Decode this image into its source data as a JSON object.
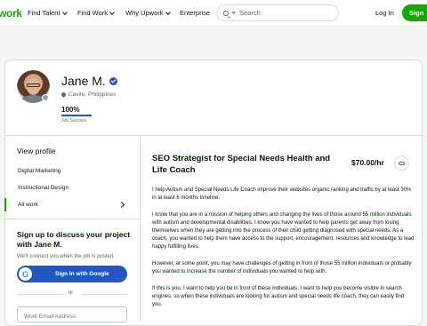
{
  "topbar": {
    "logo": "work",
    "nav": [
      "Find Talent",
      "Find Work",
      "Why Upwork",
      "Enterprise"
    ],
    "search_placeholder": "Search",
    "login": "Log In",
    "signup": "Sign"
  },
  "profile": {
    "name": "Jane M.",
    "location": "Cavite, Philippines",
    "jss_value": "100%",
    "jss_label": "Job Success",
    "jss_fraction": 1.0
  },
  "sidebar": {
    "view_profile": "View profile",
    "items": [
      {
        "label": "Digital Marketing"
      },
      {
        "label": "Instructional Design"
      },
      {
        "label": "All work"
      }
    ],
    "signup_title": "Sign up to discuss your project with Jane M.",
    "signup_sub": "We'll connect you when the job is posted.",
    "google_letter": "G",
    "google_label": "Sign In with Google",
    "or": "or",
    "email_placeholder": "Work Email Address"
  },
  "main": {
    "title": "SEO Strategist for Special Needs Health and Life Coach",
    "rate": "$70.00/hr",
    "paragraphs": [
      "I help Autism and Special Needs Life Coach improve their websites organic ranking and traffic by at least 30% in at least 6 months timeline.",
      "I know that you are in a mission of helping others and changing the lives of those around 55 million individuals with autism and developmental disabilities. I know you have wanted to help parents get away from losing themselves when they are getting into the process of their child getting diagnosed with special needs. As a coach, you wanted to help them have access to the support, encouragement, resources and knowledge to lead happy fulfilling lives.",
      "However, at some point, you may have challenges of getting in front of those 55 million individuals or probably you wanted to increase the number of individuals you wanted to help with.",
      "If this is you, I want to help you be in front of these individuals. I want to help you become visible in search engines, so when these individuals are looking for autism and special needs life coach, they can easily find you."
    ]
  },
  "colors": {
    "brand_green": "#14a800",
    "link_blue": "#1f57c3",
    "text": "#001e00",
    "muted": "#5e6d55"
  }
}
